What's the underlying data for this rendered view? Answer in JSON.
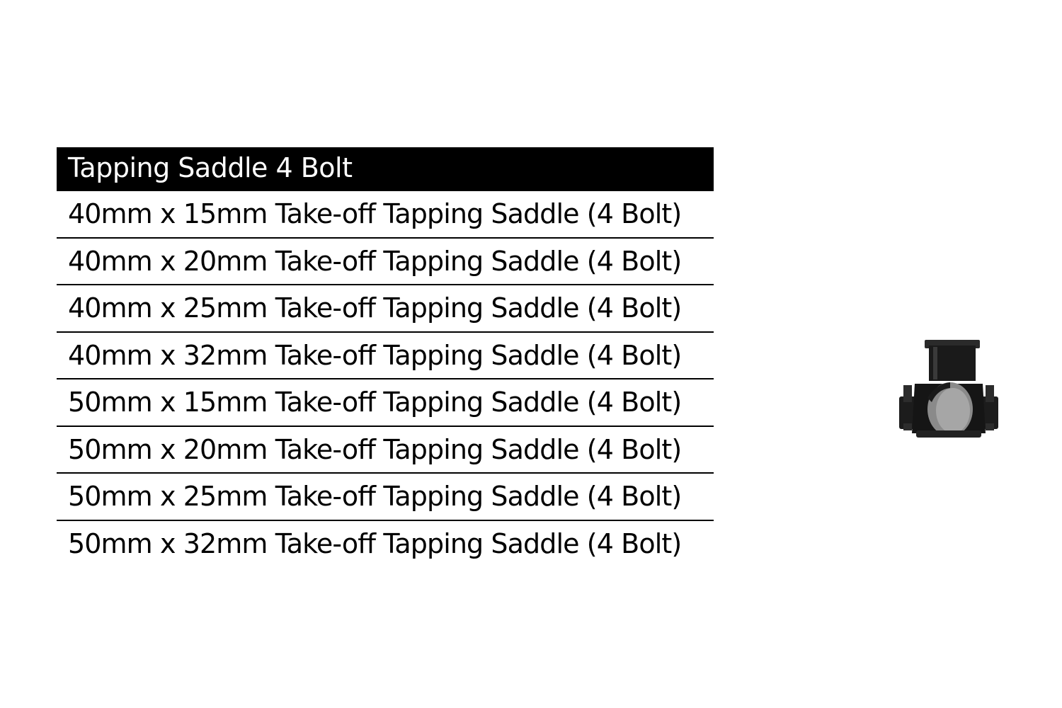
{
  "table": {
    "header": "Tapping Saddle 4 Bolt",
    "rows": [
      "40mm x 15mm Take-off  Tapping Saddle (4 Bolt)",
      "40mm x 20mm Take-off  Tapping Saddle (4 Bolt)",
      "40mm x 25mm Take-off  Tapping Saddle (4 Bolt)",
      "40mm x 32mm Take-off  Tapping Saddle (4 Bolt)",
      "50mm x 15mm Take-off  Tapping Saddle (4 Bolt)",
      "50mm x 20mm Take-off  Tapping Saddle (4 Bolt)",
      "50mm x 25mm Take-off  Tapping Saddle (4 Bolt)",
      "50mm x 32mm Take-off  Tapping Saddle (4 Bolt)"
    ]
  },
  "image": {
    "icon": "tapping-saddle-fitting-icon",
    "color": "#1a1a1a"
  }
}
